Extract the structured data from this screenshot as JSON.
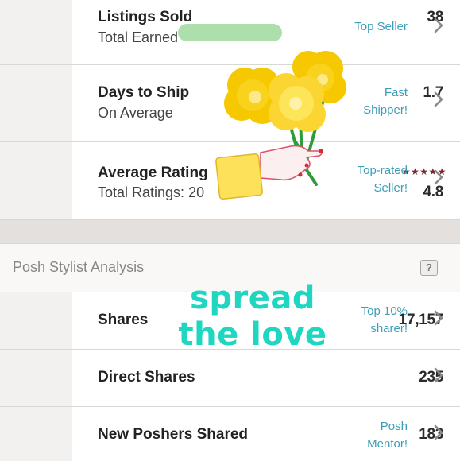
{
  "stats": [
    {
      "number": "38",
      "title": "Listings Sold",
      "subtitle": "Total Earned",
      "badge": [
        "Top Seller"
      ]
    },
    {
      "number": "1.7",
      "title": "Days to Ship",
      "subtitle": "On Average",
      "badge": [
        "Fast",
        "Shipper!"
      ]
    },
    {
      "number": "4.8",
      "stars": "★★★★★",
      "title": "Average Rating",
      "subtitle": "Total Ratings: 20",
      "badge": [
        "Top-rated",
        "Seller!"
      ]
    }
  ],
  "section": {
    "title": "Posh Stylist Analysis",
    "help_label": "?"
  },
  "stylist_rows": [
    {
      "number": "17,157",
      "title": "Shares",
      "badge": [
        "Top 10%",
        "sharer!"
      ]
    },
    {
      "number": "235",
      "title": "Direct Shares",
      "badge": []
    },
    {
      "number": "183",
      "title": "New Poshers Shared",
      "badge": [
        "Posh",
        "Mentor!"
      ]
    }
  ],
  "overlay": {
    "text_line1": "spread",
    "text_line2": "the love"
  },
  "colors": {
    "accent": "#3c9fb8",
    "star": "#7a2734",
    "overlay_text": "#1fd6c0",
    "redaction": "#a6dca6",
    "flower": "#f5c800"
  },
  "icons": {
    "row_chevron": "chevron-right-icon",
    "help": "question-icon"
  }
}
